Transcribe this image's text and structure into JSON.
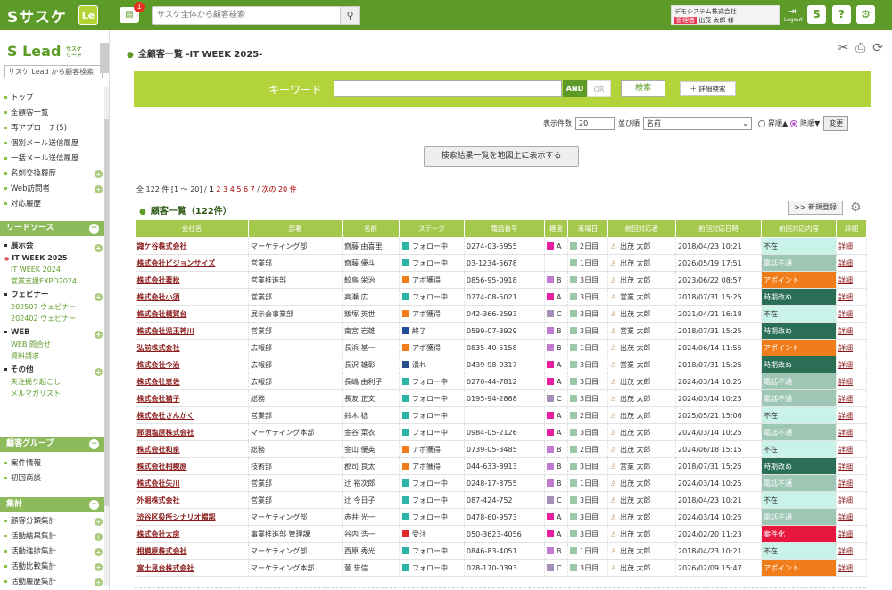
{
  "header": {
    "logo": "Sサスケ",
    "le_label": "Le",
    "chat_badge": "1",
    "search_placeholder": "サスケ全体から顧客検索",
    "company": "デモシステム株式会社",
    "role": "管理者",
    "user": "出茂 太郎 様",
    "logout": "Logout"
  },
  "sidebar": {
    "logo": "Lead",
    "logo_sub": "サスケ リード",
    "search_placeholder": "サスケ Lead から顧客検索",
    "menu": [
      "トップ",
      "全顧客一覧",
      "再アプローチ(5)",
      "個別メール送信履歴",
      "一括メール送信履歴",
      "名刺交換履歴",
      "Web訪問者",
      "対応履歴"
    ],
    "lead_source_header": "リードソース",
    "exhibition": "展示会",
    "exhibitions": [
      "IT WEEK 2025",
      "IT WEEK 2024",
      "営業支援EXPO2024"
    ],
    "webinar": "ウェビナー",
    "webinars": [
      "202507 ウェビナー",
      "202402 ウェビナー"
    ],
    "web": "WEB",
    "web_items": [
      "WEB 問合せ",
      "資料請求"
    ],
    "other": "その他",
    "other_items": [
      "失注掘り起こし",
      "メルマガリスト"
    ],
    "group_header": "顧客グループ",
    "group_items": [
      "案件情報",
      "初回商談"
    ],
    "summary_header": "集計",
    "summary_items": [
      "顧客分類集計",
      "活動結果集計",
      "活動進捗集計",
      "活動比較集計",
      "活動履歴集計"
    ]
  },
  "main": {
    "title": "全顧客一覧 -IT WEEK 2025-",
    "keyword_label": "キーワード",
    "and": "AND",
    "or": "OR",
    "search": "検索",
    "detail_search": "＋ 詳細検索",
    "count_label": "表示件数",
    "count_value": "20",
    "sort_label": "並び順",
    "sort_value": "名前",
    "asc": "昇順▲",
    "desc": "降順▼",
    "change": "変更",
    "map_button": "検索結果一覧を地図上に表示する",
    "pager_text": "全 122 件 [1 〜 20] /",
    "pager_current": "1",
    "pager_pages": [
      "2",
      "3",
      "4",
      "5",
      "6",
      "7"
    ],
    "pager_next": "次の 20 件",
    "list_title": "顧客一覧（122件）",
    "new_button": ">> 新規登録"
  },
  "colors": {
    "follow": "#2bb5a6",
    "apo": "#f07c1a",
    "done": "#1f4e9a",
    "lost": "#264f8c",
    "order": "#e02a2a",
    "rankA": "#e61ea0",
    "rankB": "#c07ad0",
    "rankC": "#a590b8",
    "days": "#9bc8a6"
  },
  "table": {
    "headers": [
      "会社名",
      "部署",
      "名前",
      "ステージ",
      "電話番号",
      "確度",
      "来場日",
      "前回対応者",
      "前回対応日時",
      "前回対応内容",
      "詳細"
    ],
    "rows": [
      [
        "諏ケ谷株式会社",
        "マーケティング部",
        "齋藤 由喜里",
        "フォロー中",
        "0274-03-5955",
        "A",
        "2日目",
        "出茂 太郎",
        "2018/04/23 10:21",
        "不在",
        "詳細"
      ],
      [
        "株式会社ビジョンサイズ",
        "営業部",
        "齋藤 優斗",
        "フォロー中",
        "03-1234-5678",
        "",
        "1日目",
        "出茂 太郎",
        "2026/05/19 17:51",
        "電話不通",
        "詳細"
      ],
      [
        "株式会社著松",
        "営業推進部",
        "鮫島 栄治",
        "アポ獲得",
        "0856-95-0918",
        "B",
        "3日目",
        "出茂 太郎",
        "2023/06/22 08:57",
        "アポイント",
        "詳細"
      ],
      [
        "株式会社小須",
        "営業部",
        "高瀬 広",
        "フォロー中",
        "0274-08-5021",
        "A",
        "3日目",
        "営業 太郎",
        "2018/07/31 15:25",
        "時期改め",
        "詳細"
      ],
      [
        "株式会社橋賀台",
        "展示会事業部",
        "飯塚 英世",
        "アポ獲得",
        "042-366-2593",
        "C",
        "3日目",
        "出茂 太郎",
        "2021/04/21 16:18",
        "不在",
        "詳細"
      ],
      [
        "株式会社児玉神川",
        "営業部",
        "南宮 岩雄",
        "終了",
        "0599-07-3929",
        "B",
        "3日目",
        "営業 太郎",
        "2018/07/31 15:25",
        "時期改め",
        "詳細"
      ],
      [
        "弘前株式会社",
        "広報部",
        "長浜 基一",
        "アポ獲得",
        "0835-40-5158",
        "B",
        "1日目",
        "出茂 太郎",
        "2024/06/14 11:55",
        "アポイント",
        "詳細"
      ],
      [
        "株式会社今治",
        "広報部",
        "長沢 雄彰",
        "潰れ",
        "0439-98-9317",
        "A",
        "3日目",
        "営業 太郎",
        "2018/07/31 15:25",
        "時期改め",
        "詳細"
      ],
      [
        "株式会社恵佐",
        "広報部",
        "長嶋 由利子",
        "フォロー中",
        "0270-44-7812",
        "A",
        "3日目",
        "出茂 太郎",
        "2024/03/14 10:25",
        "電話不通",
        "詳細"
      ],
      [
        "株式会社猫子",
        "総務",
        "長友 正文",
        "フォロー中",
        "0195-94-2868",
        "C",
        "3日目",
        "出茂 太郎",
        "2024/03/14 10:25",
        "電話不通",
        "詳細"
      ],
      [
        "株式会社さんかく",
        "営業部",
        "鈴木 稔",
        "フォロー中",
        "",
        "A",
        "2日目",
        "出茂 太郎",
        "2025/05/21 15:06",
        "不在",
        "詳細"
      ],
      [
        "那須塩原株式会社",
        "マーケティング本部",
        "金谷 菜衣",
        "フォロー中",
        "0984-05-2126",
        "A",
        "3日目",
        "出茂 太郎",
        "2024/03/14 10:25",
        "電話不通",
        "詳細"
      ],
      [
        "株式会社和泉",
        "総務",
        "金山 優英",
        "アポ獲得",
        "0739-05-3485",
        "B",
        "2日目",
        "出茂 太郎",
        "2024/06/18 15:15",
        "不在",
        "詳細"
      ],
      [
        "株式会社相模原",
        "技術部",
        "郡司 良太",
        "アポ獲得",
        "044-633-8913",
        "B",
        "3日目",
        "営業 太郎",
        "2018/07/31 15:25",
        "時期改め",
        "詳細"
      ],
      [
        "株式会社矢川",
        "営業部",
        "辻 裕次郎",
        "フォロー中",
        "0248-17-3755",
        "B",
        "1日目",
        "出茂 太郎",
        "2024/03/14 10:25",
        "電話不通",
        "詳細"
      ],
      [
        "外堀株式会社",
        "営業部",
        "辻 今日子",
        "フォロー中",
        "087-424-752",
        "C",
        "3日目",
        "出茂 太郎",
        "2018/04/23 10:21",
        "不在",
        "詳細"
      ],
      [
        "渋谷区役所シナリオ帽認",
        "マーケティング部",
        "赤井 光一",
        "フォロー中",
        "0478-60-9573",
        "A",
        "3日目",
        "出茂 太郎",
        "2024/03/14 10:25",
        "電話不通",
        "詳細"
      ],
      [
        "株式会社大房",
        "事業推進部 管理課",
        "谷内 浩一",
        "受注",
        "050-3623-4056",
        "A",
        "3日目",
        "出茂 太郎",
        "2024/02/20 11:23",
        "案件化",
        "詳細"
      ],
      [
        "相模原株式会社",
        "マーケティング部",
        "西原 秀光",
        "フォロー中",
        "0846-83-4051",
        "B",
        "1日目",
        "出茂 太郎",
        "2018/04/23 10:21",
        "不在",
        "詳細"
      ],
      [
        "富士見台株式会社",
        "マーケティング本部",
        "菅 誉信",
        "フォロー中",
        "028-170-0393",
        "C",
        "3日目",
        "出茂 太郎",
        "2026/02/09 15:47",
        "アポイント",
        "詳細"
      ]
    ]
  }
}
